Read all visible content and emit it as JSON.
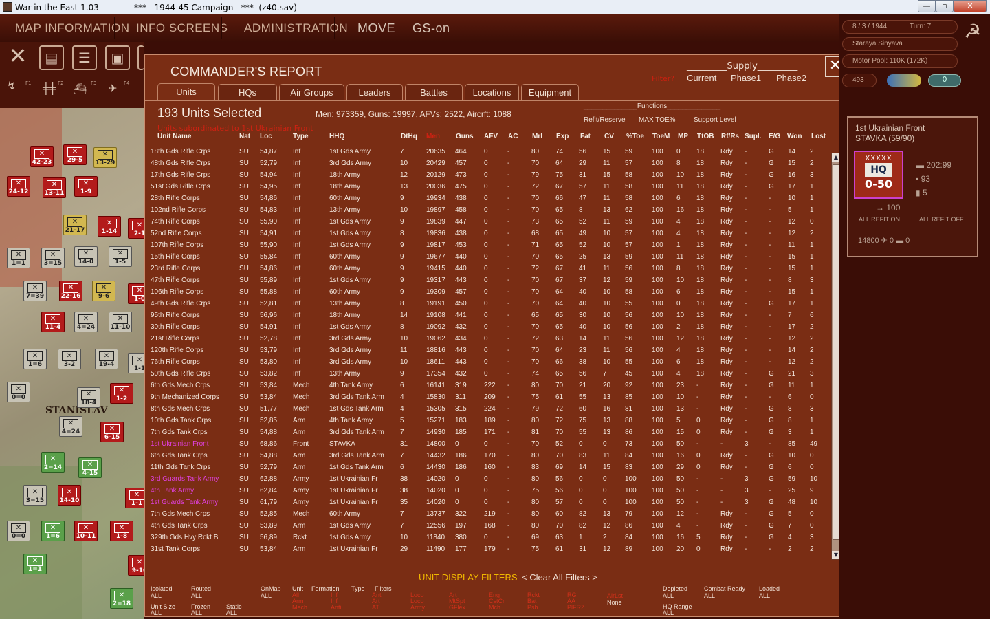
{
  "window": {
    "title_left": "War in the East 1.03",
    "title_mid": "***   1944-45 Campaign   ***  (z40.sav)",
    "min": "—",
    "max": "▫",
    "close": "✕"
  },
  "menu": {
    "map_info": "MAP INFORMATION",
    "info_screens": "INFO SCREENS",
    "administration": "ADMINISTRATION",
    "mode": "MOVE",
    "gs": "GS-on"
  },
  "toolbar": {
    "f1": "F1",
    "f2": "F2",
    "f3": "F3",
    "f4": "F4"
  },
  "map": {
    "city": "STANISLAV",
    "counters": [
      "42-23",
      "29-5",
      "13-29",
      "24-12",
      "13-11",
      "1-9",
      "21-17",
      "1-14",
      "2-1",
      "1=1",
      "3=15",
      "14-0",
      "1-5",
      "7=39",
      "22-16",
      "9-6",
      "1-0",
      "11-4",
      "4=24",
      "11-10",
      "1=6",
      "3-2",
      "19-4",
      "1-1",
      "0=0",
      "18-4",
      "1-2",
      "4=24",
      "6-15",
      "2=14",
      "4-15",
      "3=15",
      "14-10",
      "1-1",
      "0=0",
      "1=6",
      "10-11",
      "1-8",
      "1=1",
      "9-10",
      "2=18"
    ]
  },
  "dialog": {
    "title": "COMMANDER'S REPORT",
    "close": "✕",
    "supply_header": "_________Supply_________",
    "supply_red": "Filter?",
    "supply_current": "Current",
    "supply_phase1": "Phase1",
    "supply_phase2": "Phase2",
    "tabs": [
      "Units",
      "HQs",
      "Air Groups",
      "Leaders",
      "Battles",
      "Locations",
      "Equipment"
    ],
    "selected": "193 Units Selected",
    "totals": "Men: 973359, Guns: 19997, AFVs: 2522, Aircrft: 1088",
    "red_sub": "Units subordinated to 1st Ukrainian Front",
    "functions_header": "______________Functions______________",
    "fn_refit": "Refit/Reserve",
    "fn_maxtoe": "MAX TOE%",
    "fn_support": "Support Level",
    "columns": [
      "Unit Name",
      "Nat",
      "Loc",
      "Type",
      "HHQ",
      "DtHq",
      "Men",
      "Guns",
      "AFV",
      "AC",
      "Mrl",
      "Exp",
      "Fat",
      "CV",
      "%Toe",
      "ToeM",
      "MP",
      "TtOB",
      "Rf/Rs",
      "Supl.",
      "E/G",
      "Won",
      "Lost"
    ],
    "rows": [
      [
        "18th Gds Rifle Crps",
        "SU",
        "54,87",
        "Inf",
        "1st Gds Army",
        "7",
        "20635",
        "464",
        "0",
        "-",
        "80",
        "74",
        "56",
        "15",
        "59",
        "100",
        "0",
        "18",
        "Rdy",
        "-",
        "G",
        "14",
        "2"
      ],
      [
        "48th Gds Rifle Crps",
        "SU",
        "52,79",
        "Inf",
        "3rd Gds Army",
        "10",
        "20429",
        "457",
        "0",
        "-",
        "70",
        "64",
        "29",
        "11",
        "57",
        "100",
        "8",
        "18",
        "Rdy",
        "-",
        "G",
        "15",
        "2"
      ],
      [
        "17th Gds Rifle Crps",
        "SU",
        "54,94",
        "Inf",
        "18th Army",
        "12",
        "20129",
        "473",
        "0",
        "-",
        "79",
        "75",
        "31",
        "15",
        "58",
        "100",
        "10",
        "18",
        "Rdy",
        "-",
        "G",
        "16",
        "3"
      ],
      [
        "51st Gds Rifle Crps",
        "SU",
        "54,95",
        "Inf",
        "18th Army",
        "13",
        "20036",
        "475",
        "0",
        "-",
        "72",
        "67",
        "57",
        "11",
        "58",
        "100",
        "11",
        "18",
        "Rdy",
        "-",
        "G",
        "17",
        "1"
      ],
      [
        "28th Rifle Corps",
        "SU",
        "54,86",
        "Inf",
        "60th Army",
        "9",
        "19934",
        "438",
        "0",
        "-",
        "70",
        "66",
        "47",
        "11",
        "58",
        "100",
        "6",
        "18",
        "Rdy",
        "-",
        "-",
        "10",
        "1"
      ],
      [
        "102nd Rifle Corps",
        "SU",
        "54,83",
        "Inf",
        "13th Army",
        "10",
        "19897",
        "458",
        "0",
        "-",
        "70",
        "65",
        "8",
        "13",
        "62",
        "100",
        "16",
        "18",
        "Rdy",
        "-",
        "-",
        "5",
        "1"
      ],
      [
        "74th Rifle Corps",
        "SU",
        "55,90",
        "Inf",
        "1st Gds Army",
        "9",
        "19839",
        "447",
        "0",
        "-",
        "73",
        "65",
        "52",
        "11",
        "59",
        "100",
        "4",
        "18",
        "Rdy",
        "-",
        "-",
        "12",
        "0"
      ],
      [
        "52nd Rifle Corps",
        "SU",
        "54,91",
        "Inf",
        "1st Gds Army",
        "8",
        "19836",
        "438",
        "0",
        "-",
        "68",
        "65",
        "49",
        "10",
        "57",
        "100",
        "4",
        "18",
        "Rdy",
        "-",
        "-",
        "12",
        "2"
      ],
      [
        "107th Rifle Corps",
        "SU",
        "55,90",
        "Inf",
        "1st Gds Army",
        "9",
        "19817",
        "453",
        "0",
        "-",
        "71",
        "65",
        "52",
        "10",
        "57",
        "100",
        "1",
        "18",
        "Rdy",
        "-",
        "-",
        "11",
        "1"
      ],
      [
        "15th Rifle Corps",
        "SU",
        "55,84",
        "Inf",
        "60th Army",
        "9",
        "19677",
        "440",
        "0",
        "-",
        "70",
        "65",
        "25",
        "13",
        "59",
        "100",
        "11",
        "18",
        "Rdy",
        "-",
        "-",
        "15",
        "1"
      ],
      [
        "23rd Rifle Corps",
        "SU",
        "54,86",
        "Inf",
        "60th Army",
        "9",
        "19415",
        "440",
        "0",
        "-",
        "72",
        "67",
        "41",
        "11",
        "56",
        "100",
        "8",
        "18",
        "Rdy",
        "-",
        "-",
        "15",
        "1"
      ],
      [
        "47th Rifle Corps",
        "SU",
        "55,89",
        "Inf",
        "1st Gds Army",
        "9",
        "19317",
        "443",
        "0",
        "-",
        "70",
        "67",
        "37",
        "12",
        "59",
        "100",
        "10",
        "18",
        "Rdy",
        "-",
        "-",
        "8",
        "3"
      ],
      [
        "106th Rifle Corps",
        "SU",
        "55,88",
        "Inf",
        "60th Army",
        "9",
        "19309",
        "457",
        "0",
        "-",
        "70",
        "64",
        "40",
        "10",
        "58",
        "100",
        "6",
        "18",
        "Rdy",
        "-",
        "-",
        "15",
        "1"
      ],
      [
        "49th Gds Rifle Crps",
        "SU",
        "52,81",
        "Inf",
        "13th Army",
        "8",
        "19191",
        "450",
        "0",
        "-",
        "70",
        "64",
        "40",
        "10",
        "55",
        "100",
        "0",
        "18",
        "Rdy",
        "-",
        "G",
        "17",
        "1"
      ],
      [
        "95th Rifle Corps",
        "SU",
        "56,96",
        "Inf",
        "18th Army",
        "14",
        "19108",
        "441",
        "0",
        "-",
        "65",
        "65",
        "30",
        "10",
        "56",
        "100",
        "10",
        "18",
        "Rdy",
        "-",
        "-",
        "7",
        "6"
      ],
      [
        "30th Rifle Corps",
        "SU",
        "54,91",
        "Inf",
        "1st Gds Army",
        "8",
        "19092",
        "432",
        "0",
        "-",
        "70",
        "65",
        "40",
        "10",
        "56",
        "100",
        "2",
        "18",
        "Rdy",
        "-",
        "-",
        "17",
        "2"
      ],
      [
        "21st Rifle Corps",
        "SU",
        "52,78",
        "Inf",
        "3rd Gds Army",
        "10",
        "19062",
        "434",
        "0",
        "-",
        "72",
        "63",
        "14",
        "11",
        "56",
        "100",
        "12",
        "18",
        "Rdy",
        "-",
        "-",
        "12",
        "2"
      ],
      [
        "120th Rifle Corps",
        "SU",
        "53,79",
        "Inf",
        "3rd Gds Army",
        "11",
        "18816",
        "443",
        "0",
        "-",
        "70",
        "64",
        "23",
        "11",
        "56",
        "100",
        "4",
        "18",
        "Rdy",
        "-",
        "-",
        "14",
        "2"
      ],
      [
        "76th Rifle Corps",
        "SU",
        "53,80",
        "Inf",
        "3rd Gds Army",
        "10",
        "18611",
        "443",
        "0",
        "-",
        "70",
        "66",
        "38",
        "10",
        "55",
        "100",
        "6",
        "18",
        "Rdy",
        "-",
        "-",
        "12",
        "2"
      ],
      [
        "50th Gds Rifle Crps",
        "SU",
        "53,82",
        "Inf",
        "13th Army",
        "9",
        "17354",
        "432",
        "0",
        "-",
        "74",
        "65",
        "56",
        "7",
        "45",
        "100",
        "4",
        "18",
        "Rdy",
        "-",
        "G",
        "21",
        "3"
      ],
      [
        "6th Gds Mech Crps",
        "SU",
        "53,84",
        "Mech",
        "4th Tank Army",
        "6",
        "16141",
        "319",
        "222",
        "-",
        "80",
        "70",
        "21",
        "20",
        "92",
        "100",
        "23",
        "-",
        "Rdy",
        "-",
        "G",
        "11",
        "1"
      ],
      [
        "9th Mechanized Corps",
        "SU",
        "53,84",
        "Mech",
        "3rd Gds Tank Arm",
        "4",
        "15830",
        "311",
        "209",
        "-",
        "75",
        "61",
        "55",
        "13",
        "85",
        "100",
        "10",
        "-",
        "Rdy",
        "-",
        "-",
        "6",
        "0"
      ],
      [
        "8th Gds Mech Crps",
        "SU",
        "51,77",
        "Mech",
        "1st Gds Tank Arm",
        "4",
        "15305",
        "315",
        "224",
        "-",
        "79",
        "72",
        "60",
        "16",
        "81",
        "100",
        "13",
        "-",
        "Rdy",
        "-",
        "G",
        "8",
        "3"
      ],
      [
        "10th Gds Tank Crps",
        "SU",
        "52,85",
        "Arm",
        "4th Tank Army",
        "5",
        "15271",
        "183",
        "189",
        "-",
        "80",
        "72",
        "75",
        "13",
        "88",
        "100",
        "5",
        "0",
        "Rdy",
        "-",
        "G",
        "8",
        "1"
      ],
      [
        "7th Gds Tank Crps",
        "SU",
        "54,88",
        "Arm",
        "3rd Gds Tank Arm",
        "7",
        "14930",
        "185",
        "171",
        "-",
        "81",
        "70",
        "55",
        "13",
        "86",
        "100",
        "15",
        "0",
        "Rdy",
        "-",
        "G",
        "3",
        "1"
      ],
      [
        "1st Ukrainian Front",
        "SU",
        "68,86",
        "Front",
        "STAVKA",
        "31",
        "14800",
        "0",
        "0",
        "-",
        "70",
        "52",
        "0",
        "0",
        "73",
        "100",
        "50",
        "-",
        "-",
        "3",
        "-",
        "85",
        "49"
      ],
      [
        "6th Gds Tank Crps",
        "SU",
        "54,88",
        "Arm",
        "3rd Gds Tank Arm",
        "7",
        "14432",
        "186",
        "170",
        "-",
        "80",
        "70",
        "83",
        "11",
        "84",
        "100",
        "16",
        "0",
        "Rdy",
        "-",
        "G",
        "10",
        "0"
      ],
      [
        "11th Gds Tank Crps",
        "SU",
        "52,79",
        "Arm",
        "1st Gds Tank Arm",
        "6",
        "14430",
        "186",
        "160",
        "-",
        "83",
        "69",
        "14",
        "15",
        "83",
        "100",
        "29",
        "0",
        "Rdy",
        "-",
        "G",
        "6",
        "0"
      ],
      [
        "3rd Guards Tank Army",
        "SU",
        "62,88",
        "Army",
        "1st Ukrainian Fr",
        "38",
        "14020",
        "0",
        "0",
        "-",
        "80",
        "56",
        "0",
        "0",
        "100",
        "100",
        "50",
        "-",
        "-",
        "3",
        "G",
        "59",
        "10"
      ],
      [
        "4th Tank Army",
        "SU",
        "62,84",
        "Army",
        "1st Ukrainian Fr",
        "38",
        "14020",
        "0",
        "0",
        "-",
        "75",
        "56",
        "0",
        "0",
        "100",
        "100",
        "50",
        "-",
        "-",
        "3",
        "-",
        "25",
        "9"
      ],
      [
        "1st Guards Tank Army",
        "SU",
        "61,79",
        "Army",
        "1st Ukrainian Fr",
        "35",
        "14020",
        "0",
        "0",
        "-",
        "80",
        "57",
        "0",
        "0",
        "100",
        "100",
        "50",
        "-",
        "-",
        "3",
        "G",
        "48",
        "10"
      ],
      [
        "7th Gds Mech Crps",
        "SU",
        "52,85",
        "Mech",
        "60th Army",
        "7",
        "13737",
        "322",
        "219",
        "-",
        "80",
        "60",
        "82",
        "13",
        "79",
        "100",
        "12",
        "-",
        "Rdy",
        "-",
        "G",
        "5",
        "0"
      ],
      [
        "4th Gds Tank Crps",
        "SU",
        "53,89",
        "Arm",
        "1st Gds Army",
        "7",
        "12556",
        "197",
        "168",
        "-",
        "80",
        "70",
        "82",
        "12",
        "86",
        "100",
        "4",
        "-",
        "Rdy",
        "-",
        "G",
        "7",
        "0"
      ],
      [
        "329th Gds Hvy Rckt B",
        "SU",
        "56,89",
        "Rckt",
        "1st Gds Army",
        "10",
        "11840",
        "380",
        "0",
        "-",
        "69",
        "63",
        "1",
        "2",
        "84",
        "100",
        "16",
        "5",
        "Rdy",
        "-",
        "G",
        "4",
        "3"
      ],
      [
        "31st Tank Corps",
        "SU",
        "53,84",
        "Arm",
        "1st Ukrainian Fr",
        "29",
        "11490",
        "177",
        "179",
        "-",
        "75",
        "61",
        "31",
        "12",
        "89",
        "100",
        "20",
        "0",
        "Rdy",
        "-",
        "-",
        "2",
        "2"
      ]
    ],
    "magenta_rows": [
      25,
      28,
      29,
      30
    ],
    "filters": {
      "title": "UNIT DISPLAY FILTERS",
      "clear": "< Clear All Filters >",
      "isolated": "Isolated",
      "isolated_v": "ALL",
      "routed": "Routed",
      "routed_v": "ALL",
      "onmap": "OnMap",
      "onmap_v": "ALL",
      "unit": "Unit",
      "formation": "Formation",
      "type": "Type",
      "filters": "Filters",
      "unitsize": "Unit Size",
      "unitsize_v": "ALL",
      "frozen": "Frozen",
      "frozen_v": "ALL",
      "static": "Static",
      "static_v": "ALL",
      "red1": "All\nArm\nMech",
      "red2": "Inf\nInf\nAnti",
      "red3": "Ant\nArt\nAT",
      "red4": "Loco\nLoco\nArmy",
      "red5": "Art\nMtSpt\nGFlex",
      "red6": "Eng\nCstCr\nMch",
      "red7": "Rckt\nBat\nPsh",
      "red8": "RG\nAA\nPlFRZ",
      "red9": "AirLst",
      "none": "None",
      "depleted": "Depleted",
      "depleted_v": "ALL",
      "combat": "Combat Ready",
      "combat_v": "ALL",
      "loaded": "Loaded",
      "loaded_v": "ALL",
      "hqrange": "HQ Range",
      "hqrange_v": "ALL"
    }
  },
  "rpanel": {
    "date": "8 / 3 / 1944",
    "turn": "Turn: 7",
    "loc": "Staraya Sinyava",
    "motor": "Motor Pool:  110K (172K)",
    "num": "493",
    "zero": "0",
    "unit_name": "1st Ukrainian Front",
    "unit_sub": "STAVKA  (59/90)",
    "hq_x": "XXXXX",
    "hq_label": "HQ",
    "hq_val": "0-50",
    "s1": "202:99",
    "s2": "93",
    "s3": "5",
    "s4": "100",
    "refit_on": "ALL REFIT ON",
    "refit_off": "ALL REFIT OFF",
    "bottom": "14800 ✈ 0     ▬ 0"
  }
}
